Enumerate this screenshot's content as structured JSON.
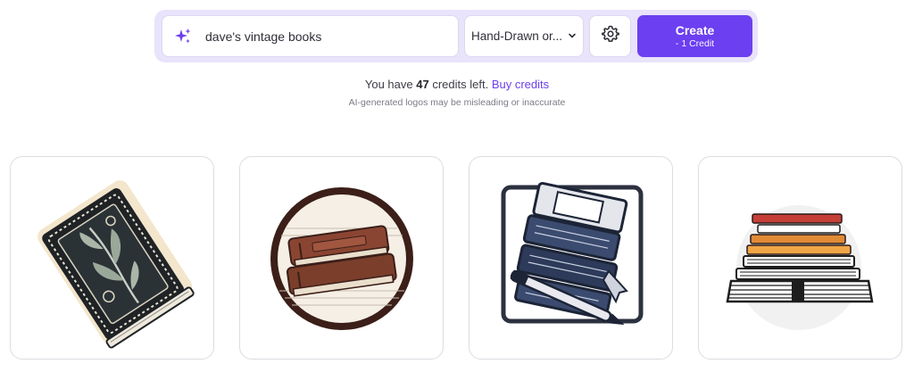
{
  "search": {
    "value": "dave's vintage books",
    "icon": "sparkle-icon"
  },
  "style": {
    "value": "Hand-Drawn or...",
    "icon": "chevron-down-icon"
  },
  "settings": {
    "icon": "gear-icon"
  },
  "create": {
    "label": "Create",
    "cost": "- 1 Credit"
  },
  "credits": {
    "prefix": "You have",
    "count": "47",
    "suffix": "credits left.",
    "buy_label": "Buy credits"
  },
  "disclaimer": "AI-generated logos may be misleading or inaccurate",
  "colors": {
    "accent": "#6c3ff0",
    "bar_bg": "#e9e3fb"
  },
  "results": [
    {
      "subject": "ornate-book-logo"
    },
    {
      "subject": "book-stack-circle-logo"
    },
    {
      "subject": "books-and-pen-logo"
    },
    {
      "subject": "stacked-books-logo"
    }
  ]
}
